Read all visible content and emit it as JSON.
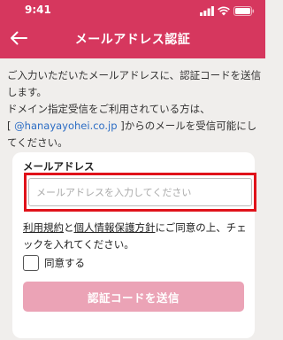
{
  "status_bar": {
    "time": "9:41"
  },
  "header": {
    "title": "メールアドレス認証"
  },
  "intro": {
    "line1": "ご入力いただいたメールアドレスに、認証コードを送信します。",
    "line2": "ドメイン指定受信をご利用されている方は、",
    "bracket_open": "[",
    "domain": "@hanayayohei.co.jp",
    "bracket_close": "]",
    "line3_rest": "からのメールを受信可能にしてください。"
  },
  "form": {
    "email_label": "メールアドレス",
    "email_placeholder": "メールアドレスを入力してください",
    "email_value": "",
    "terms_link": "利用規約",
    "and_text": "と",
    "privacy_link": "個人情報保護方針",
    "consent_rest": "にご同意の上、チェックを入れてください。",
    "agree_label": "同意する",
    "submit_label": "認証コードを送信"
  },
  "colors": {
    "header": "#d6375e",
    "submit_disabled": "#eba3b6",
    "highlight": "#e0121a",
    "link": "#2b6cc4"
  }
}
